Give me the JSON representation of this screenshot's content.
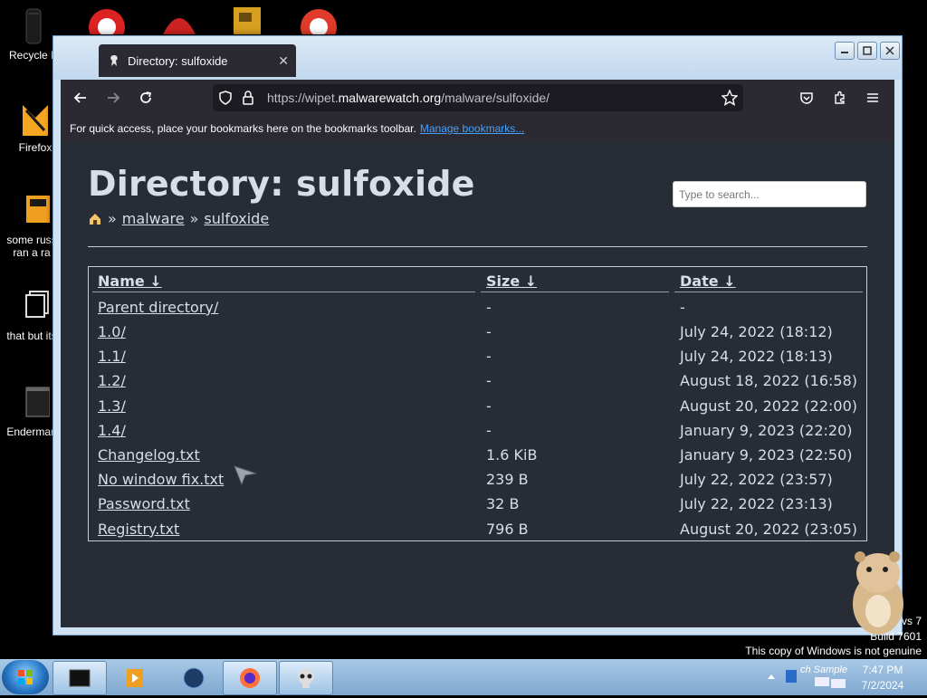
{
  "desktop": {
    "icons": [
      {
        "label": "Recycle B"
      },
      {
        "label": "Firefox"
      },
      {
        "label": "some russ ran a ra"
      },
      {
        "label": "that but its"
      },
      {
        "label": "Enderman"
      }
    ],
    "watermark": {
      "line1": "vs 7",
      "line2": "Build 7601",
      "genuine": "This copy of Windows is not genuine"
    }
  },
  "browser": {
    "tab_title": "Directory: sulfoxide",
    "url_prefix": "https://wipet.",
    "url_domain": "malwarewatch.org",
    "url_path": "/malware/sulfoxide/",
    "bookmarks_text": "For quick access, place your bookmarks here on the bookmarks toolbar.",
    "bookmarks_link": "Manage bookmarks..."
  },
  "page": {
    "title": "Directory: sulfoxide",
    "breadcrumb": {
      "sep": "»",
      "items": [
        "malware",
        "sulfoxide"
      ]
    },
    "search_placeholder": "Type to search...",
    "columns": {
      "name": "Name ↓",
      "size": "Size ↓",
      "date": "Date ↓"
    },
    "rows": [
      {
        "name": "Parent directory/",
        "size": "-",
        "date": "-"
      },
      {
        "name": "1.0/",
        "size": "-",
        "date": "July 24, 2022 (18:12)"
      },
      {
        "name": "1.1/",
        "size": "-",
        "date": "July 24, 2022 (18:13)"
      },
      {
        "name": "1.2/",
        "size": "-",
        "date": "August 18, 2022 (16:58)"
      },
      {
        "name": "1.3/",
        "size": "-",
        "date": "August 20, 2022 (22:00)"
      },
      {
        "name": "1.4/",
        "size": "-",
        "date": "January 9, 2023 (22:20)"
      },
      {
        "name": "Changelog.txt",
        "size": "1.6 KiB",
        "date": "January 9, 2023 (22:50)"
      },
      {
        "name": "No window fix.txt",
        "size": "239 B",
        "date": "July 22, 2022 (23:57)"
      },
      {
        "name": "Password.txt",
        "size": "32 B",
        "date": "July 22, 2022 (23:13)"
      },
      {
        "name": "Registry.txt",
        "size": "796 B",
        "date": "August 20, 2022 (23:05)"
      }
    ]
  },
  "taskbar": {
    "time": "7:47 PM",
    "date": "7/2/2024",
    "tray_text": "ch Sample"
  }
}
